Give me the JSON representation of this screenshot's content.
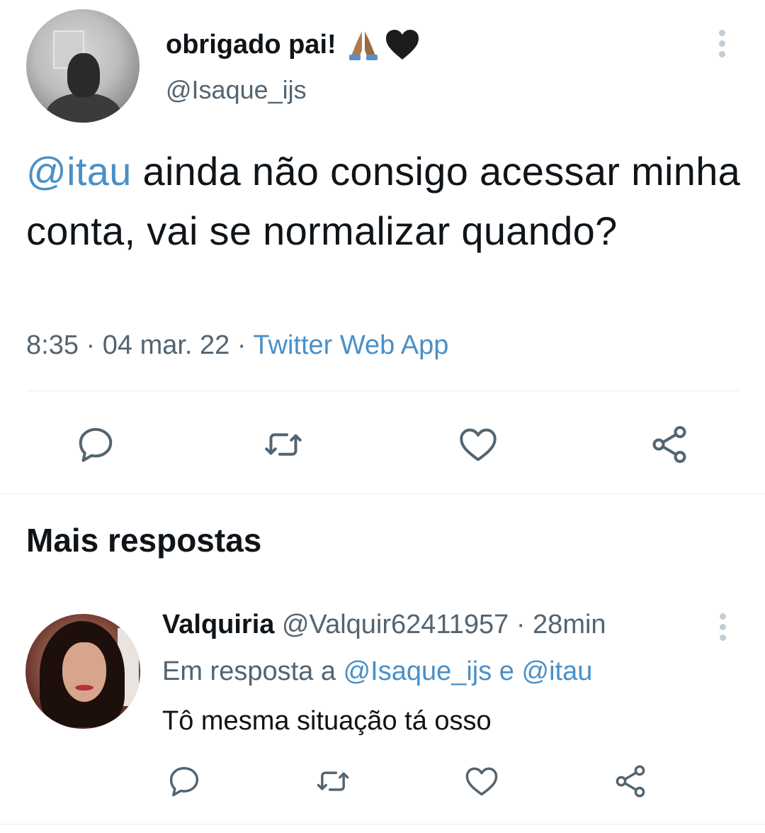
{
  "main_tweet": {
    "display_name": "obrigado pai!",
    "handle": "@Isaque_ijs",
    "text_mention": "@itau",
    "text_body": " ainda não consigo acessar minha conta, vai se normalizar quando?",
    "time": "8:35",
    "date": "04 mar. 22",
    "source": "Twitter Web App",
    "separator": " · "
  },
  "actions": {
    "reply_icon": "reply-icon",
    "retweet_icon": "retweet-icon",
    "like_icon": "heart-icon",
    "share_icon": "share-icon"
  },
  "section": {
    "title": "Mais respostas"
  },
  "reply": {
    "display_name": "Valquiria",
    "handle": "@Valquir62411957",
    "separator": " · ",
    "time_ago": "28min",
    "context_prefix": "Em resposta a ",
    "context_mention_1": "@Isaque_ijs",
    "context_join": " e ",
    "context_mention_2": "@itau",
    "text": "Tô mesma situação tá osso"
  },
  "colors": {
    "text": "#0f1419",
    "secondary": "#536471",
    "link": "#4a90c8",
    "icon": "#536471",
    "divider": "#e6ecf0"
  }
}
